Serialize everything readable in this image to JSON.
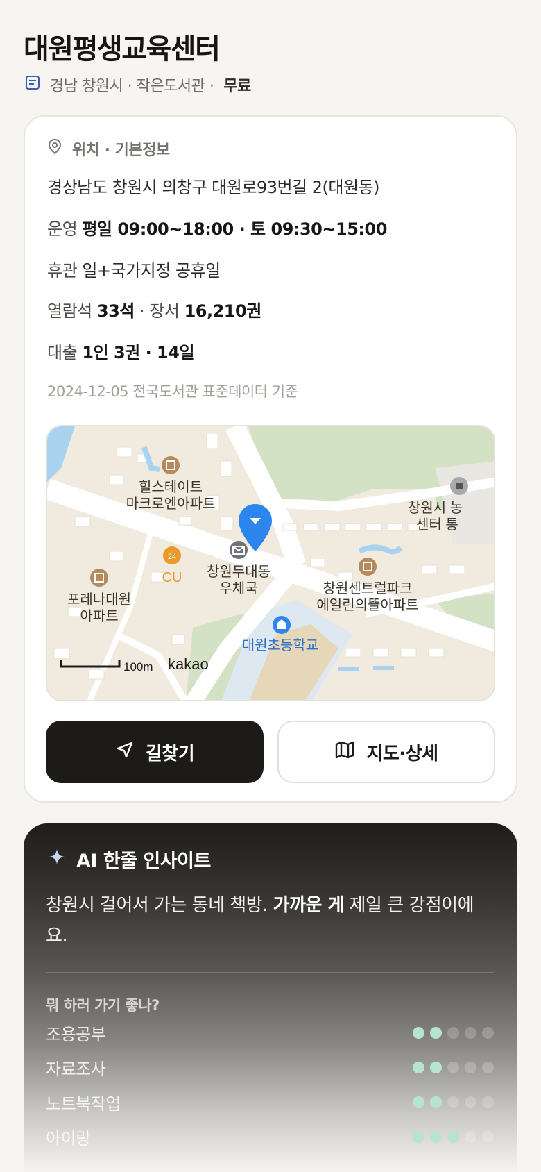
{
  "header": {
    "title": "대원평생교육센터",
    "region": "경남 창원시 · 작은도서관 ·",
    "fee": "무료",
    "doc_icon": "document-icon"
  },
  "info": {
    "section_title": "위치 · 기본정보",
    "pin_icon": "map-pin-icon",
    "address": "경상남도 창원시 의창구 대원로93번길 2(대원동)",
    "hours_label": "운영",
    "hours_value": "평일 09:00~18:00 · 토 09:30~15:00",
    "closed_label": "휴관",
    "closed_value": "일+국가지정 공휴일",
    "seats_label": "열람석",
    "seats_value": "33석",
    "books_label": "장서",
    "books_value": "16,210권",
    "loan_label": "대출",
    "loan_value": "1인 3권 · 14일",
    "basis": "2024-12-05 전국도서관 표준데이터 기준"
  },
  "map": {
    "labels": {
      "hills": "힐스테이트",
      "hills2": "마크로엔아파트",
      "cu": "CU",
      "cu_badge": "24",
      "forena": "포레나대원",
      "forena2": "아파트",
      "post": "창원두대동",
      "post2": "우체국",
      "central": "창원센트럴파크",
      "central2": "에일린의뜰아파트",
      "school": "대원초등학교",
      "center": "창원시 농",
      "center2": "센터 통",
      "scale": "100m",
      "brand": "kakao"
    },
    "colors": {
      "land": "#f1ebdf",
      "road": "#ffffff",
      "green": "#d3e2c4",
      "water": "#a8d2ee",
      "pin": "#2d86ee",
      "poi": "#b58a5c",
      "school_text": "#2d6fc4",
      "cu": "#e89a2c"
    }
  },
  "actions": {
    "route_label": "길찾기",
    "route_icon": "navigation-arrow-icon",
    "map_label": "지도·상세",
    "map_icon": "folded-map-icon"
  },
  "ai": {
    "title": "AI 한줄 인사이트",
    "sparkle_icon": "sparkle-icon",
    "text_before": "창원시 걸어서 가는 동네 책방. ",
    "text_bold": "가까운 게",
    "text_after": " 제일 큰 강점이에요.",
    "question": "뭐 하러 가기 좋나?",
    "ratings": [
      {
        "name": "조용공부",
        "score": 2,
        "max": 5
      },
      {
        "name": "자료조사",
        "score": 2,
        "max": 5
      },
      {
        "name": "노트북작업",
        "score": 2,
        "max": 5
      },
      {
        "name": "아이랑",
        "score": 3,
        "max": 5
      }
    ],
    "accent": "#b7e4d0"
  }
}
